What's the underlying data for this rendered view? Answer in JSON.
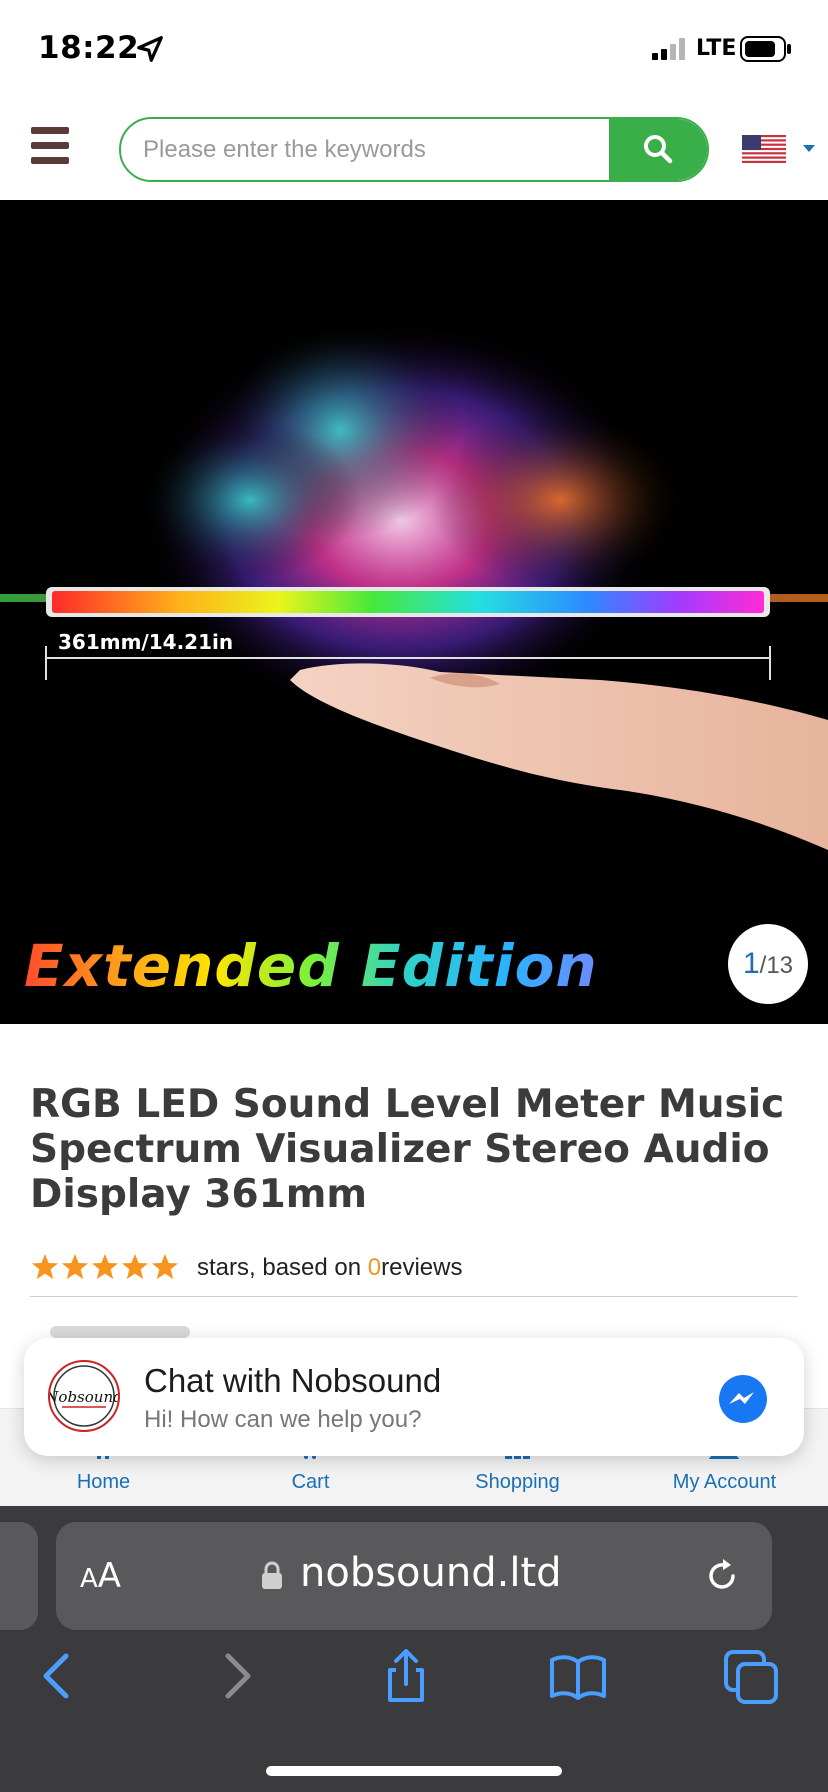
{
  "status_bar": {
    "time": "18:22",
    "network": "LTE"
  },
  "header": {
    "search_placeholder": "Please enter the keywords",
    "search_value": "",
    "accent_color": "#3aae48",
    "flag": "us-flag-icon"
  },
  "hero": {
    "dimension_label": "361mm/14.21in",
    "caption": "Extended Edition",
    "pager_current": "1",
    "pager_total": "/13"
  },
  "product": {
    "title": "RGB LED Sound Level Meter Music Spectrum Visualizer Stereo Audio Display 361mm",
    "rating_stars": 5,
    "rating_prefix": "stars, based on ",
    "review_count": "0",
    "rating_suffix": "reviews",
    "star_color": "#f7941d"
  },
  "bottom_nav": {
    "items": [
      {
        "label": "Home",
        "icon": "home-icon"
      },
      {
        "label": "Cart",
        "icon": "cart-icon"
      },
      {
        "label": "Shopping",
        "icon": "grid-icon"
      },
      {
        "label": "My Account",
        "icon": "user-icon"
      }
    ],
    "color": "#1a6fb5"
  },
  "chat": {
    "title": "Chat with Nobsound",
    "subtitle": "Hi! How can we help you?",
    "logo_text": "Nobsound",
    "icon": "messenger-icon"
  },
  "browser": {
    "text_size_label_large": "A",
    "text_size_label_small": "A",
    "url": "nobsound.ltd",
    "toolbar": [
      "back-icon",
      "forward-icon",
      "share-icon",
      "bookmarks-icon",
      "tabs-icon"
    ]
  }
}
